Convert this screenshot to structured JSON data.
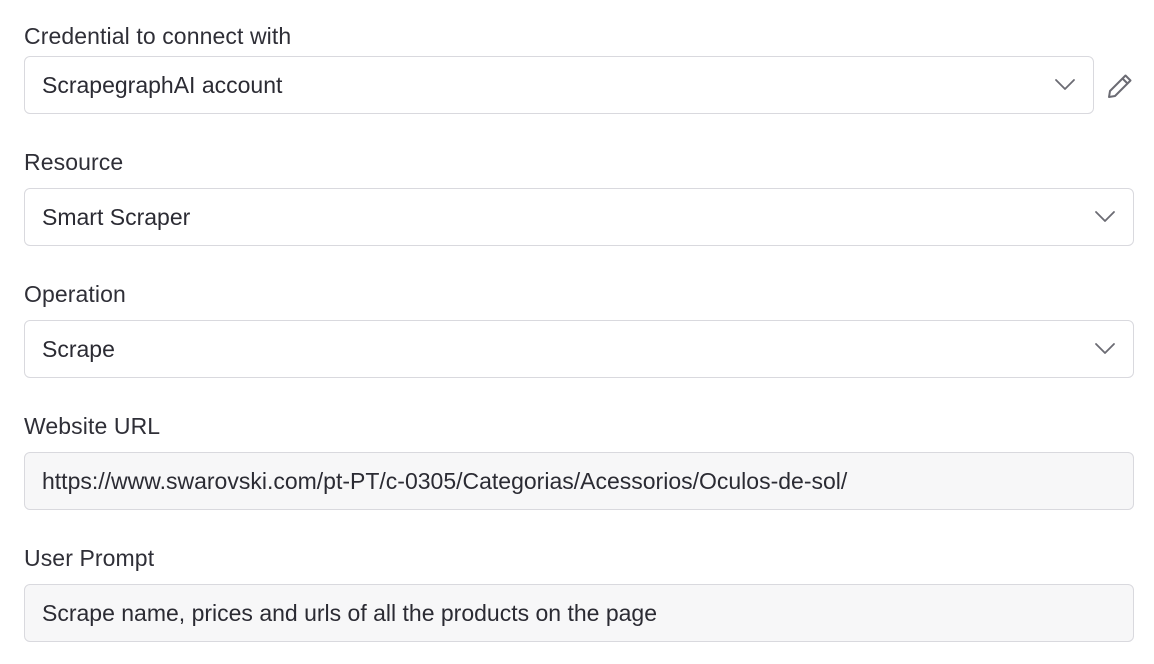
{
  "credential": {
    "label": "Credential to connect with",
    "value": "ScrapegraphAI account",
    "edit_icon": "pencil-icon",
    "dropdown_icon": "chevron-down-icon"
  },
  "resource": {
    "label": "Resource",
    "value": "Smart Scraper",
    "dropdown_icon": "chevron-down-icon"
  },
  "operation": {
    "label": "Operation",
    "value": "Scrape",
    "dropdown_icon": "chevron-down-icon"
  },
  "website_url": {
    "label": "Website URL",
    "value": "https://www.swarovski.com/pt-PT/c-0305/Categorias/Acessorios/Oculos-de-sol/"
  },
  "user_prompt": {
    "label": "User Prompt",
    "value": "Scrape name, prices and urls of all the products on the page"
  },
  "colors": {
    "text": "#2b2b33",
    "border": "#d9d9de",
    "input_background": "#f7f7f8",
    "icon": "#6b6b73"
  }
}
